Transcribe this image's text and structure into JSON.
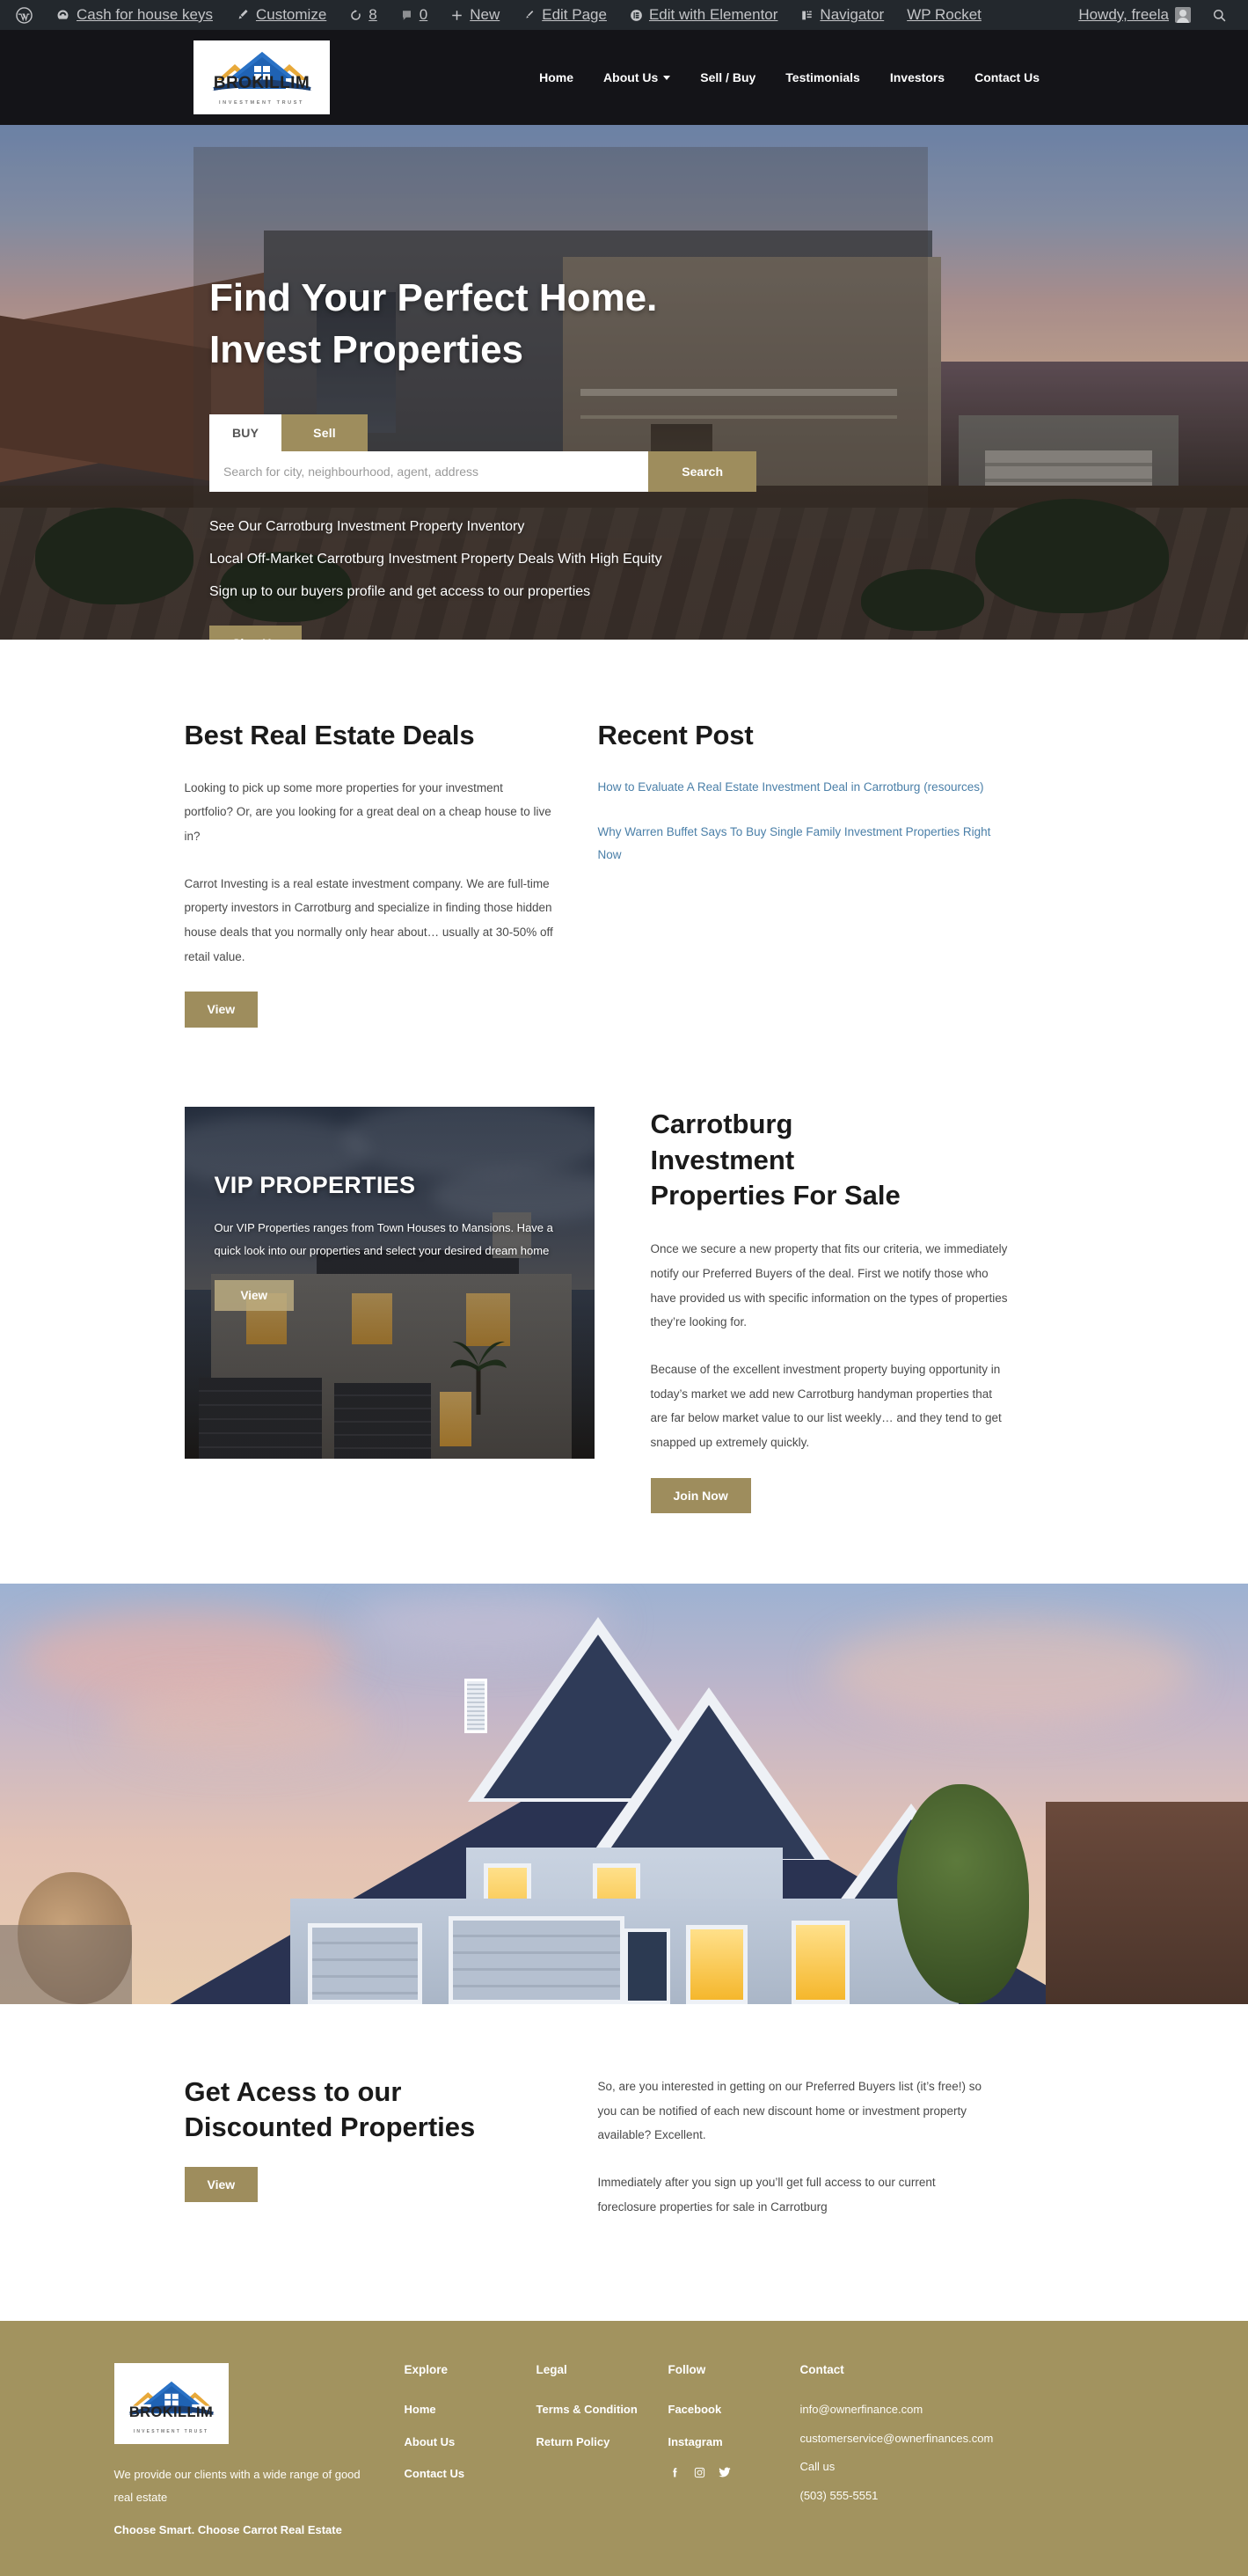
{
  "adminbar": {
    "items": [
      {
        "icon": "wordpress-icon",
        "label": ""
      },
      {
        "icon": "dashboard-icon",
        "label": "Cash for house keys"
      },
      {
        "icon": "brush-icon",
        "label": "Customize"
      },
      {
        "icon": "updates-icon",
        "label": "8"
      },
      {
        "icon": "comments-icon",
        "label": "0"
      },
      {
        "icon": "plus-icon",
        "label": "New"
      },
      {
        "icon": "pencil-icon",
        "label": "Edit Page"
      },
      {
        "icon": "elementor-icon",
        "label": "Edit with Elementor"
      },
      {
        "icon": "navigator-icon",
        "label": "Navigator"
      },
      {
        "icon": "rocket-icon",
        "label": "WP Rocket"
      }
    ],
    "howdy": "Howdy, freela",
    "avatar_icon": "avatar-icon",
    "search_icon": "search-icon"
  },
  "brand": {
    "name": "BROKILLIM",
    "tagline": "INVESTMENT TRUST"
  },
  "nav": {
    "items": [
      {
        "label": "Home",
        "has_caret": false
      },
      {
        "label": "About Us",
        "has_caret": true
      },
      {
        "label": "Sell / Buy",
        "has_caret": false
      },
      {
        "label": "Testimonials",
        "has_caret": false
      },
      {
        "label": "Investors",
        "has_caret": false
      },
      {
        "label": "Contact Us",
        "has_caret": false
      }
    ]
  },
  "hero": {
    "heading_line1": "Find Your Perfect Home.",
    "heading_line2": "Invest Properties",
    "tab_buy": "BUY",
    "tab_sell": "Sell",
    "search_placeholder": "Search for city, neighbourhood, agent, address",
    "search_value": "",
    "search_button": "Search",
    "line1": "See Our Carrotburg Investment Property Inventory",
    "line2": "Local Off-Market Carrotburg Investment Property Deals With High Equity",
    "line3": "Sign up to our buyers profile and get access to our properties",
    "signup_button": "Sign Up"
  },
  "deals": {
    "title": "Best Real Estate Deals",
    "p1": "Looking to pick up some more properties for your investment portfolio? Or, are you looking for a great deal on a cheap house to live in?",
    "p2": "Carrot Investing is a real estate investment company. We are full-time property investors in Carrotburg and specialize in finding those hidden house deals that you normally only hear about… usually at 30-50% off retail value.",
    "button": "View"
  },
  "recent_post": {
    "title": "Recent Post",
    "posts": [
      "How to Evaluate A Real Estate Investment Deal in Carrotburg (resources)",
      "Why Warren Buffet Says To Buy Single Family Investment Properties Right Now"
    ]
  },
  "vip": {
    "title": "VIP PROPERTIES",
    "text": "Our VIP Properties ranges from Town Houses to Mansions. Have a quick look into our properties and select your desired dream home",
    "button": "View"
  },
  "carrotburg": {
    "title_line1": "Carrotburg",
    "title_line2": "Investment",
    "title_line3": "Properties For Sale",
    "p1": "Once we secure a new property that fits our criteria, we immediately notify our Preferred Buyers of the deal. First we notify those who have provided us with specific information on the types of properties they’re looking for.",
    "p2": "Because of the excellent investment property buying opportunity in today’s market we add new Carrotburg handyman properties that are far below market value to our list weekly… and they tend to get snapped up extremely quickly.",
    "button": "Join Now"
  },
  "access": {
    "title_line1": "Get Acess to our",
    "title_line2": "Discounted Properties",
    "button": "View",
    "p1": "So, are you interested in getting on our Preferred Buyers list (it’s free!) so you can be notified of each new discount home or investment property available? Excellent.",
    "p2": "Immediately after you sign up you’ll get full access to our current foreclosure properties for sale in Carrotburg"
  },
  "footer": {
    "desc": "We provide our clients with a wide range of good real estate",
    "tagline": "Choose Smart. Choose Carrot Real Estate",
    "explore": {
      "heading": "Explore",
      "links": [
        "Home",
        "About Us",
        "Contact Us"
      ]
    },
    "legal": {
      "heading": "Legal",
      "links": [
        "Terms & Condition",
        "Return Policy"
      ]
    },
    "follow": {
      "heading": "Follow",
      "links": [
        "Facebook",
        "Instagram"
      ],
      "social_icons": [
        "facebook-icon",
        "instagram-icon",
        "twitter-icon"
      ]
    },
    "contact": {
      "heading": "Contact",
      "email1": "info@ownerfinance.com",
      "email2": "customerservice@ownerfinances.com",
      "call_label": "Call us",
      "phone": "(503) 555-5551"
    }
  },
  "colors": {
    "gold": "#9e8d5d",
    "footer_gold": "#a2935f",
    "header_dark": "#141418",
    "adminbar": "#23282d",
    "link_blue": "#4a7fa8"
  }
}
